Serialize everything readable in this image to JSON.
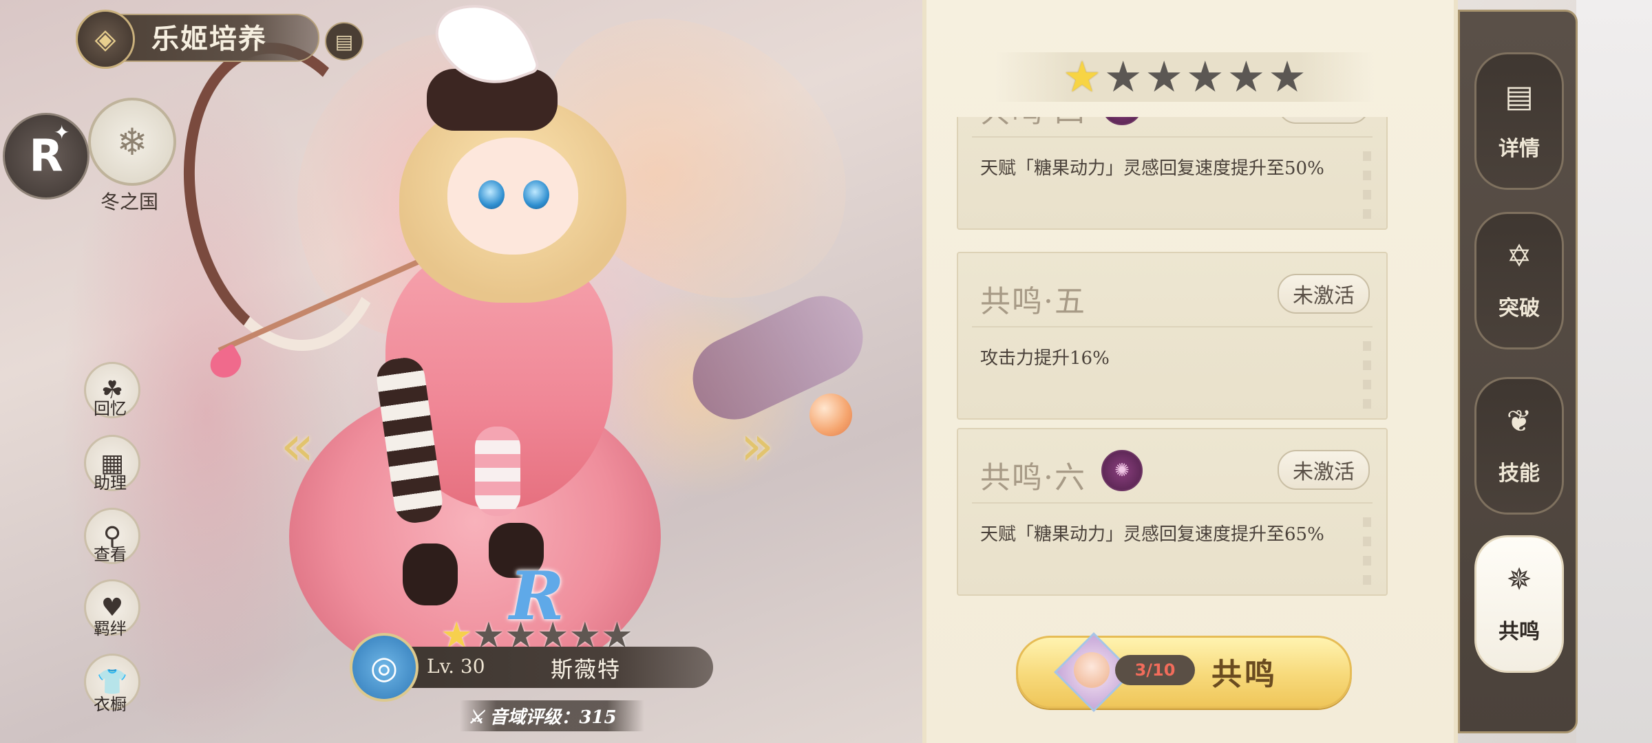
{
  "header": {
    "title": "乐姬培养"
  },
  "character": {
    "rarity": "R",
    "nation": "冬之国",
    "level": "Lv. 30",
    "name": "斯薇特",
    "stars_filled": 1,
    "stars_total": 6,
    "rating": "音域评级：315"
  },
  "side_nav": [
    {
      "label": "回忆",
      "icon": "memory-icon"
    },
    {
      "label": "助理",
      "icon": "assistant-icon"
    },
    {
      "label": "查看",
      "icon": "view-icon"
    },
    {
      "label": "羁绊",
      "icon": "bond-icon"
    },
    {
      "label": "衣橱",
      "icon": "wardrobe-icon"
    }
  ],
  "resonance_panel": {
    "stars_filled": 1,
    "stars_total": 6,
    "cards": [
      {
        "title": "共鸣·四",
        "state": "未激活",
        "desc": "天赋「糖果动力」灵感回复速度提升至50%",
        "has_icon": true
      },
      {
        "title": "共鸣·五",
        "state": "未激活",
        "desc": "攻击力提升16%",
        "has_icon": false
      },
      {
        "title": "共鸣·六",
        "state": "未激活",
        "desc": "天赋「糖果动力」灵感回复速度提升至65%",
        "has_icon": true
      }
    ],
    "button": {
      "count": "3/10",
      "label": "共鸣"
    }
  },
  "tabs": [
    {
      "label": "详情",
      "icon": "details-icon",
      "active": false
    },
    {
      "label": "突破",
      "icon": "breakthrough-icon",
      "active": false
    },
    {
      "label": "技能",
      "icon": "skill-icon",
      "active": false
    },
    {
      "label": "共鸣",
      "icon": "resonance-icon",
      "active": true
    }
  ],
  "colors": {
    "accent_gold": "#f6d04d",
    "panel_bg": "#f3ecd9",
    "rail_bg": "#4b423b",
    "resonance_count": "#f26c5b"
  }
}
